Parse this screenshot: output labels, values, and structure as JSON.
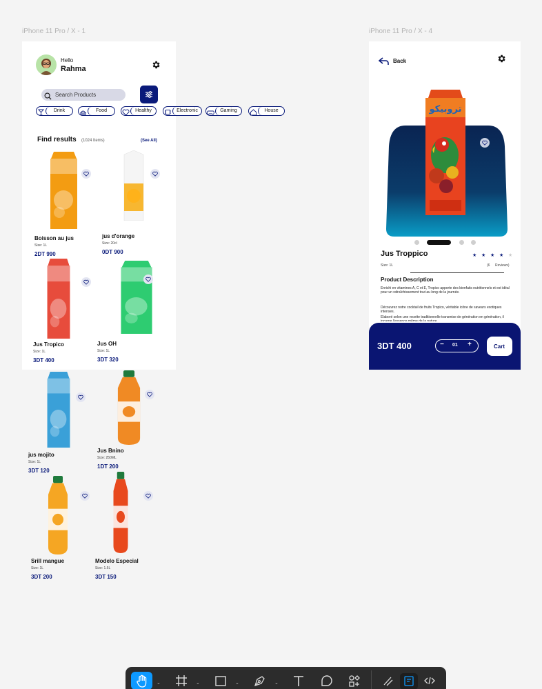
{
  "canvas": {
    "frame1_label": "iPhone 11 Pro / X - 1",
    "frame2_label": "iPhone 11 Pro / X - 4"
  },
  "home": {
    "greeting": "Hello",
    "user_name": "Rahma",
    "search": {
      "placeholder": "Search Products"
    },
    "categories": [
      "Drink",
      "Food",
      "Healthy",
      "Electronic",
      "Gaming",
      "House"
    ],
    "results_title": "Find results",
    "results_count": "(1024 Items)",
    "see_all": "(See All)",
    "products": [
      {
        "name": "Boisson au jus",
        "size": "Size: 1L",
        "price": "2DT 990",
        "color": "#f39c12"
      },
      {
        "name": "jus d'orange",
        "size": "Size: 20cl",
        "price": "0DT 900",
        "color": "#f7b731"
      },
      {
        "name": "Jus Tropico",
        "size": "Size: 1L",
        "price": "3DT 400",
        "color": "#e74c3c"
      },
      {
        "name": "Jus OH",
        "size": "Size: 1L",
        "price": "3DT 320",
        "color": "#2ecc71"
      },
      {
        "name": "jus mojito",
        "size": "Size: 1L",
        "price": "3DT 120",
        "color": "#3aa0d8"
      },
      {
        "name": "Jus Bnino",
        "size": "Size: 250ML",
        "price": "1DT 200",
        "color": "#f08a24"
      },
      {
        "name": "Srill mangue",
        "size": "Size: 1L",
        "price": "3DT 200",
        "color": "#f5a623"
      },
      {
        "name": "Modelo Especial",
        "size": "Size: 1.5L",
        "price": "3DT 150",
        "color": "#e8491d"
      }
    ]
  },
  "detail": {
    "back_label": "Back",
    "product_name": "Jus Troppico",
    "size": "Size: 1L",
    "rating": {
      "stars": 4,
      "max": 5,
      "reviews_count": "(6",
      "reviews_label": "Reviews)"
    },
    "description_title": "Product Description",
    "description_p1": "Enrichi en vitamines A, C et E, Tropico apporte des bienfaits nutritionnels et est idéal pour un rafraîchissement tout au long de la journée.",
    "description_p2": "Découvrez notre cocktail de fruits Tropico, véritable icône de saveurs exotiques intenses.",
    "description_p3": "Élaboré selon une recette traditionnelle transmise de génération en génération, il incarne l'essence même de la nature.",
    "price": "3DT 400",
    "quantity": "01",
    "minus": "−",
    "plus": "+",
    "cart_label": "Cart",
    "carousel": {
      "count": 4,
      "active": 1
    }
  },
  "toolbar": {
    "tools": [
      "hand-tool-icon",
      "frame-tool-icon",
      "rectangle-tool-icon",
      "pen-tool-icon",
      "text-tool-icon",
      "comment-tool-icon",
      "components-icon",
      "draw-mode-icon",
      "design-mode-icon",
      "dev-mode-icon"
    ],
    "accent": "#0d99ff"
  }
}
